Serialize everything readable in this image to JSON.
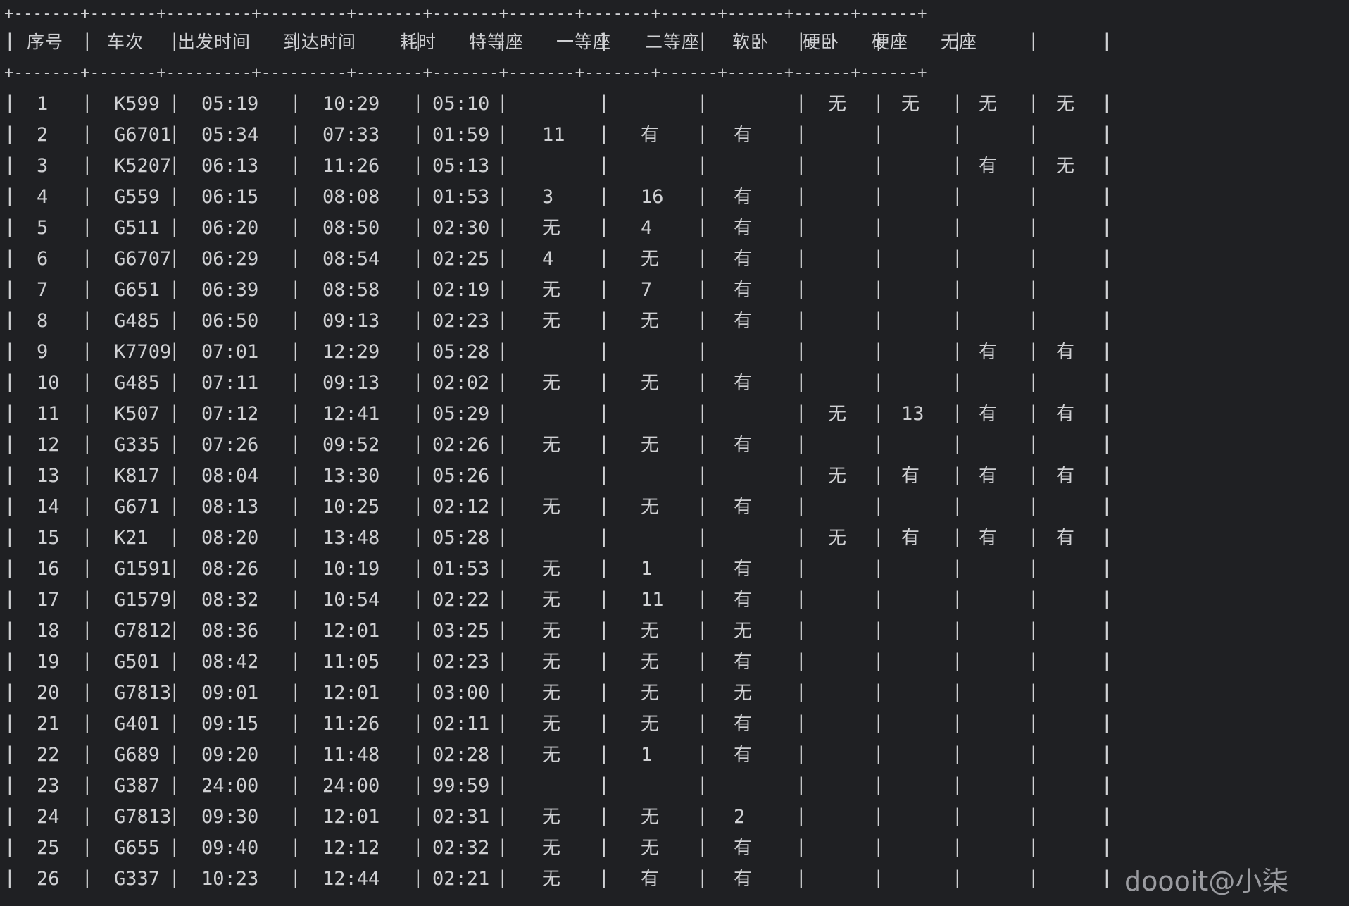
{
  "table": {
    "border_line": "+-------+-------+---------+---------+-------+-------+-------+-------+------+------+------+------+",
    "headers": [
      "序号",
      "车次",
      "出发时间",
      "到达时间",
      "耗时",
      "特等座",
      "一等座",
      "二等座",
      "软卧",
      "硬卧",
      "硬座",
      "无座"
    ],
    "rows": [
      [
        "1",
        "K599",
        "05:19",
        "10:29",
        "05:10",
        "",
        "",
        "",
        "无",
        "无",
        "无",
        "无"
      ],
      [
        "2",
        "G6701",
        "05:34",
        "07:33",
        "01:59",
        "11",
        "有",
        "有",
        "",
        "",
        "",
        ""
      ],
      [
        "3",
        "K5207",
        "06:13",
        "11:26",
        "05:13",
        "",
        "",
        "",
        "",
        "",
        "有",
        "无"
      ],
      [
        "4",
        "G559",
        "06:15",
        "08:08",
        "01:53",
        "3",
        "16",
        "有",
        "",
        "",
        "",
        ""
      ],
      [
        "5",
        "G511",
        "06:20",
        "08:50",
        "02:30",
        "无",
        "4",
        "有",
        "",
        "",
        "",
        ""
      ],
      [
        "6",
        "G6707",
        "06:29",
        "08:54",
        "02:25",
        "4",
        "无",
        "有",
        "",
        "",
        "",
        ""
      ],
      [
        "7",
        "G651",
        "06:39",
        "08:58",
        "02:19",
        "无",
        "7",
        "有",
        "",
        "",
        "",
        ""
      ],
      [
        "8",
        "G485",
        "06:50",
        "09:13",
        "02:23",
        "无",
        "无",
        "有",
        "",
        "",
        "",
        ""
      ],
      [
        "9",
        "K7709",
        "07:01",
        "12:29",
        "05:28",
        "",
        "",
        "",
        "",
        "",
        "有",
        "有"
      ],
      [
        "10",
        "G485",
        "07:11",
        "09:13",
        "02:02",
        "无",
        "无",
        "有",
        "",
        "",
        "",
        ""
      ],
      [
        "11",
        "K507",
        "07:12",
        "12:41",
        "05:29",
        "",
        "",
        "",
        "无",
        "13",
        "有",
        "有"
      ],
      [
        "12",
        "G335",
        "07:26",
        "09:52",
        "02:26",
        "无",
        "无",
        "有",
        "",
        "",
        "",
        ""
      ],
      [
        "13",
        "K817",
        "08:04",
        "13:30",
        "05:26",
        "",
        "",
        "",
        "无",
        "有",
        "有",
        "有"
      ],
      [
        "14",
        "G671",
        "08:13",
        "10:25",
        "02:12",
        "无",
        "无",
        "有",
        "",
        "",
        "",
        ""
      ],
      [
        "15",
        "K21",
        "08:20",
        "13:48",
        "05:28",
        "",
        "",
        "",
        "无",
        "有",
        "有",
        "有"
      ],
      [
        "16",
        "G1591",
        "08:26",
        "10:19",
        "01:53",
        "无",
        "1",
        "有",
        "",
        "",
        "",
        ""
      ],
      [
        "17",
        "G1579",
        "08:32",
        "10:54",
        "02:22",
        "无",
        "11",
        "有",
        "",
        "",
        "",
        ""
      ],
      [
        "18",
        "G7812",
        "08:36",
        "12:01",
        "03:25",
        "无",
        "无",
        "无",
        "",
        "",
        "",
        ""
      ],
      [
        "19",
        "G501",
        "08:42",
        "11:05",
        "02:23",
        "无",
        "无",
        "有",
        "",
        "",
        "",
        ""
      ],
      [
        "20",
        "G7813",
        "09:01",
        "12:01",
        "03:00",
        "无",
        "无",
        "无",
        "",
        "",
        "",
        ""
      ],
      [
        "21",
        "G401",
        "09:15",
        "11:26",
        "02:11",
        "无",
        "无",
        "有",
        "",
        "",
        "",
        ""
      ],
      [
        "22",
        "G689",
        "09:20",
        "11:48",
        "02:28",
        "无",
        "1",
        "有",
        "",
        "",
        "",
        ""
      ],
      [
        "23",
        "G387",
        "24:00",
        "24:00",
        "99:59",
        "",
        "",
        "",
        "",
        "",
        "",
        ""
      ],
      [
        "24",
        "G7813",
        "09:30",
        "12:01",
        "02:31",
        "无",
        "无",
        "2",
        "",
        "",
        "",
        ""
      ],
      [
        "25",
        "G655",
        "09:40",
        "12:12",
        "02:32",
        "无",
        "无",
        "有",
        "",
        "",
        "",
        ""
      ],
      [
        "26",
        "G337",
        "10:23",
        "12:44",
        "02:21",
        "无",
        "有",
        "有",
        "",
        "",
        "",
        ""
      ]
    ]
  },
  "watermark": "doooit@小柒"
}
